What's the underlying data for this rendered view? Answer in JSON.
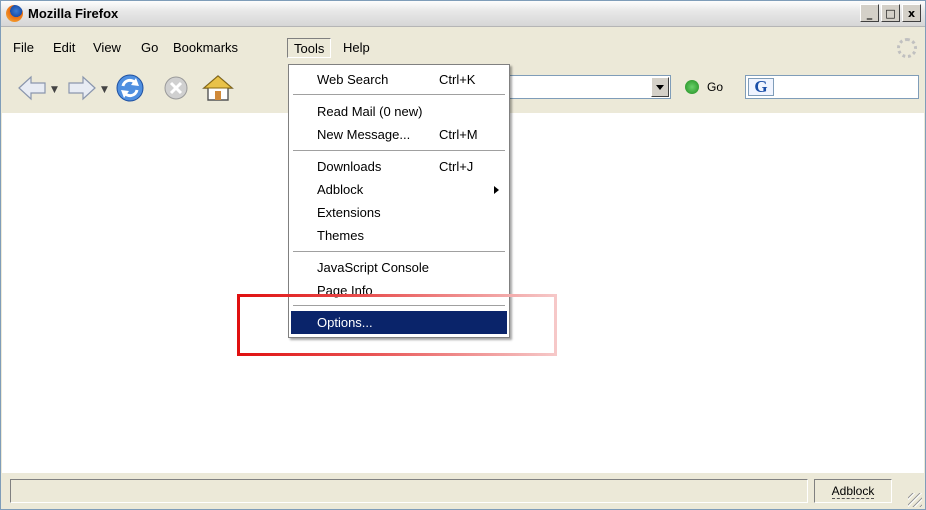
{
  "window": {
    "title": "Mozilla Firefox",
    "controls": [
      "_",
      "□",
      "x"
    ]
  },
  "menubar": {
    "items": [
      "File",
      "Edit",
      "View",
      "Go",
      "Bookmarks",
      "Tools",
      "Help"
    ]
  },
  "toolbar": {
    "icons": [
      "back-arrow-icon",
      "forward-arrow-icon",
      "reload-icon",
      "stop-icon",
      "home-icon"
    ],
    "url_value": "",
    "go_label": "Go",
    "search_engine_glyph": "G",
    "search_value": ""
  },
  "tools_menu": {
    "items": [
      {
        "label": "Web Search",
        "shortcut": "Ctrl+K"
      },
      {
        "label": "Read Mail (0 new)",
        "shortcut": ""
      },
      {
        "label": "New Message...",
        "shortcut": "Ctrl+M"
      },
      {
        "label": "Downloads",
        "shortcut": "Ctrl+J"
      },
      {
        "label": "Adblock",
        "shortcut": ""
      },
      {
        "label": "Extensions",
        "shortcut": ""
      },
      {
        "label": "Themes",
        "shortcut": ""
      },
      {
        "label": "JavaScript Console",
        "shortcut": ""
      },
      {
        "label": "Page Info",
        "shortcut": ""
      },
      {
        "label": "Options...",
        "shortcut": ""
      }
    ],
    "highlighted": "Options..."
  },
  "statusbar": {
    "adblock_label": "Adblock"
  },
  "colors": {
    "highlight": "#0a246a",
    "annotation": "#e01010",
    "chrome": "#ece9d8"
  }
}
